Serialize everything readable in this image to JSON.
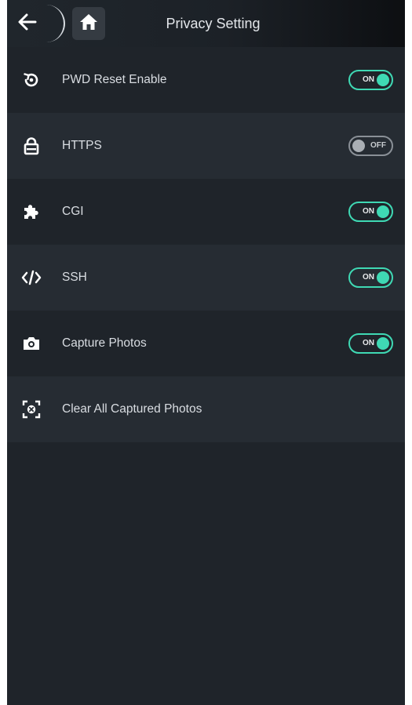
{
  "header": {
    "title": "Privacy Setting",
    "back_icon": "arrow-left-icon",
    "home_icon": "home-icon"
  },
  "settings": [
    {
      "label": "PWD Reset Enable",
      "icon": "reset-icon",
      "toggle": true,
      "state": "ON"
    },
    {
      "label": "HTTPS",
      "icon": "lock-icon",
      "toggle": true,
      "state": "OFF"
    },
    {
      "label": "CGI",
      "icon": "puzzle-icon",
      "toggle": true,
      "state": "ON"
    },
    {
      "label": "SSH",
      "icon": "code-icon",
      "toggle": true,
      "state": "ON"
    },
    {
      "label": "Capture Photos",
      "icon": "camera-icon",
      "toggle": true,
      "state": "ON"
    },
    {
      "label": "Clear All Captured Photos",
      "icon": "clear-photos-icon",
      "toggle": false
    }
  ],
  "colors": {
    "background": "#1f242a",
    "row_alt": "#262c33",
    "accent": "#3fd9b4",
    "text": "#d9dde2"
  }
}
